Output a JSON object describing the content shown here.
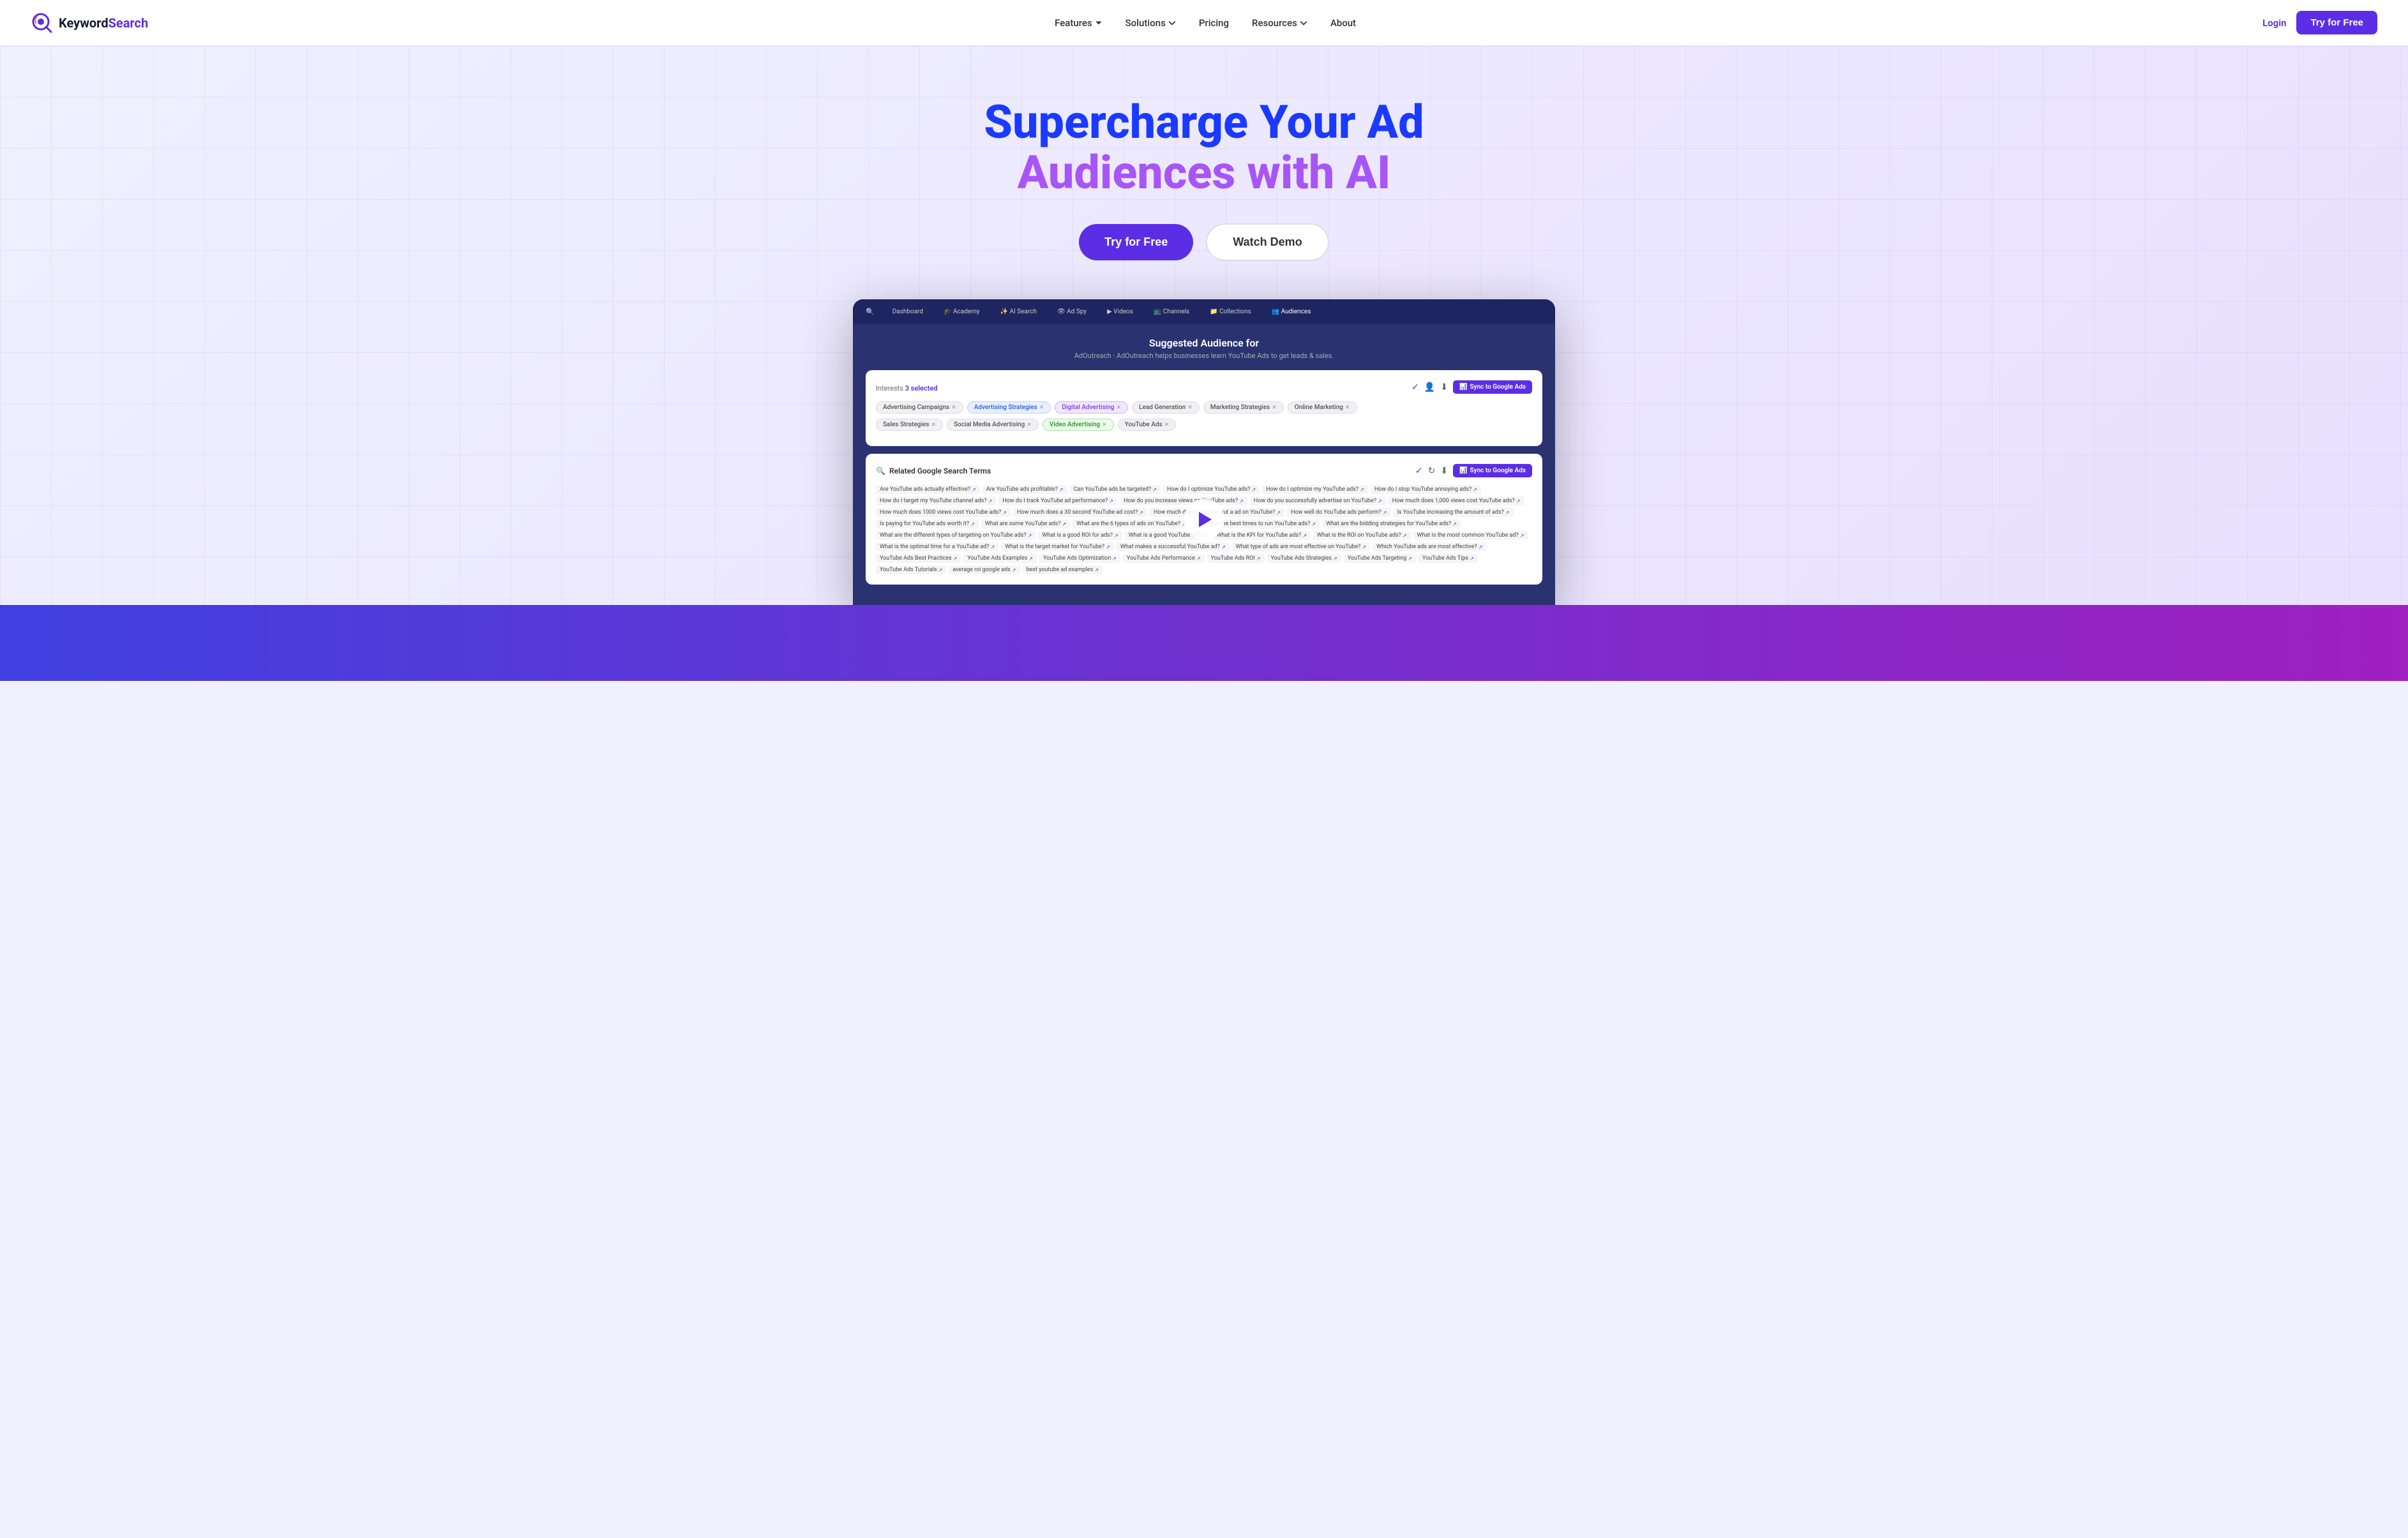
{
  "nav": {
    "logo_keyword": "Keyword",
    "logo_search": "Search",
    "links": [
      {
        "label": "Features",
        "has_dropdown": true
      },
      {
        "label": "Solutions",
        "has_dropdown": true
      },
      {
        "label": "Pricing",
        "has_dropdown": false
      },
      {
        "label": "Resources",
        "has_dropdown": true
      },
      {
        "label": "About",
        "has_dropdown": false
      }
    ],
    "login_label": "Login",
    "try_label": "Try for Free"
  },
  "hero": {
    "title_line1_blue": "Supercharge Your Ad",
    "title_line2_purple": "Audiences with AI",
    "cta_primary": "Try for Free",
    "cta_secondary": "Watch Demo"
  },
  "app_preview": {
    "nav_items": [
      "Dashboard",
      "Academy",
      "AI Search",
      "Ad Spy",
      "Videos",
      "Channels",
      "Collections",
      "Audiences"
    ],
    "section_title": "Suggested Audience for",
    "section_sub": "AdOutreach · AdOutreach helps businesses learn YouTube Ads to get leads & sales.",
    "interests_label": "Interests",
    "interests_count": "3 selected",
    "sync_label": "Sync to Google Ads",
    "interests_tags": [
      {
        "label": "Advertising Campaigns",
        "style": "default"
      },
      {
        "label": "Advertising Strategies",
        "style": "blue"
      },
      {
        "label": "Digital Advertising",
        "style": "purple"
      },
      {
        "label": "Lead Generation",
        "style": "default"
      },
      {
        "label": "Marketing Strategies",
        "style": "default"
      },
      {
        "label": "Online Marketing",
        "style": "default"
      },
      {
        "label": "Sales Strategies",
        "style": "default"
      },
      {
        "label": "Social Media Advertising",
        "style": "default"
      },
      {
        "label": "Video Advertising",
        "style": "green"
      },
      {
        "label": "YouTube Ads",
        "style": "default"
      }
    ],
    "related_section_title": "Related Google Search Terms",
    "search_terms": [
      "Are YouTube ads actually effective?",
      "Are YouTube ads profitable?",
      "Can YouTube ads be targeted?",
      "How do I optimize YouTube ads?",
      "How do I optimize my YouTube ads?",
      "How do I stop YouTube annoying ads?",
      "How do I target my YouTube channel ads?",
      "How do I track YouTube ad performance?",
      "How do you increase views on YouTube ads?",
      "How do you successfully advertise on YouTube?",
      "How much does 1,000 views cost YouTube ads?",
      "How much does 1000 views cost YouTube ads?",
      "How much does a 30 second YouTube ad cost?",
      "How much does it cost to put a ad on YouTube?",
      "How well do YouTube ads perform?",
      "Is YouTube increasing the amount of ads?",
      "Is paying for YouTube ads worth it?",
      "What are some YouTube ads?",
      "What are the 6 types of ads on YouTube?",
      "What are the best times to run YouTube ads?",
      "What are the bidding strategies for YouTube ads?",
      "What are the different types of targeting on YouTube ads?",
      "What is a good ROI for ads?",
      "What is a good YouTube ad?",
      "What is the KPI for YouTube ads?",
      "What is the ROI on YouTube ads?",
      "What is the most common YouTube ad?",
      "What is the optimal time for a YouTube ad?",
      "What is the target market for YouTube?",
      "What makes a successful YouTube ad?",
      "What type of ads are most effective on YouTube?",
      "Which YouTube ads are most effective?",
      "YouTube Ads Best Practices",
      "YouTube Ads Examples",
      "YouTube Ads Optimization",
      "YouTube Ads Performance",
      "YouTube Ads ROI",
      "YouTube Ads Strategies",
      "YouTube Ads Targeting",
      "YouTube Ads Tips",
      "YouTube Ads Tutorials",
      "average roi google ads",
      "best youtube ad examples"
    ]
  }
}
